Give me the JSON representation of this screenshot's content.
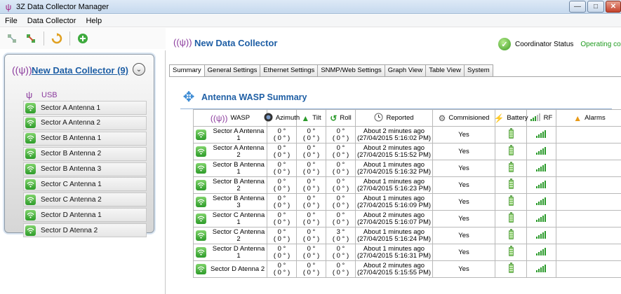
{
  "window": {
    "title": "3Z Data Collector Manager",
    "minimize": "—",
    "maximize": "□",
    "close": "✕"
  },
  "menu": [
    "File",
    "Data Collector",
    "Help"
  ],
  "sidebar": {
    "collector_name": "New Data Collector (9)",
    "usb_label": "USB",
    "items": [
      "Sector A Antenna 1",
      "Sector A Antenna 2",
      "Sector B Antenna 1",
      "Sector B Antenna 2",
      "Sector B Antenna 3",
      "Sector C Antenna 1",
      "Sector C Antenna 2",
      "Sector D Antenna 1",
      "Sector D Atenna 2"
    ]
  },
  "main": {
    "title": "New Data Collector",
    "coordinator_label": "Coordinator Status",
    "coordinator_value": "Operating correctly",
    "tabs": [
      "Summary",
      "General Settings",
      "Ethernet Settings",
      "SNMP/Web Settings",
      "Graph View",
      "Table View",
      "System"
    ],
    "section_title": "Antenna WASP Summary"
  },
  "table": {
    "headers": [
      "WASP",
      "Azimuth",
      "Tilt",
      "Roll",
      "Reported",
      "Commisioned",
      "Battery",
      "RF",
      "Alarms"
    ],
    "rows": [
      {
        "name": "Sector A Antenna 1",
        "az1": "0 °",
        "az2": "( 0 ° )",
        "tilt1": "0 °",
        "tilt2": "( 0 ° )",
        "roll1": "0 °",
        "roll2": "( 0 ° )",
        "rep1": "About 2 minutes ago",
        "rep2": "(27/04/2015 5:16:02 PM)",
        "comm": "Yes"
      },
      {
        "name": "Sector A Antenna 2",
        "az1": "0 °",
        "az2": "( 0 ° )",
        "tilt1": "0 °",
        "tilt2": "( 0 ° )",
        "roll1": "0 °",
        "roll2": "( 0 ° )",
        "rep1": "About 2 minutes ago",
        "rep2": "(27/04/2015 5:15:52 PM)",
        "comm": "Yes"
      },
      {
        "name": "Sector B Antenna 1",
        "az1": "0 °",
        "az2": "( 0 ° )",
        "tilt1": "0 °",
        "tilt2": "( 0 ° )",
        "roll1": "0 °",
        "roll2": "( 0 ° )",
        "rep1": "About 1 minutes ago",
        "rep2": "(27/04/2015 5:16:32 PM)",
        "comm": "Yes"
      },
      {
        "name": "Sector B Antenna 2",
        "az1": "0 °",
        "az2": "( 0 ° )",
        "tilt1": "0 °",
        "tilt2": "( 0 ° )",
        "roll1": "0 °",
        "roll2": "( 0 ° )",
        "rep1": "About 1 minutes ago",
        "rep2": "(27/04/2015 5:16:23 PM)",
        "comm": "Yes"
      },
      {
        "name": "Sector B Antenna 3",
        "az1": "0 °",
        "az2": "( 0 ° )",
        "tilt1": "0 °",
        "tilt2": "( 0 ° )",
        "roll1": "0 °",
        "roll2": "( 0 ° )",
        "rep1": "About 1 minutes ago",
        "rep2": "(27/04/2015 5:16:09 PM)",
        "comm": "Yes"
      },
      {
        "name": "Sector C Antenna 1",
        "az1": "0 °",
        "az2": "( 0 ° )",
        "tilt1": "0 °",
        "tilt2": "( 0 ° )",
        "roll1": "0 °",
        "roll2": "( 0 ° )",
        "rep1": "About 2 minutes ago",
        "rep2": "(27/04/2015 5:16:07 PM)",
        "comm": "Yes"
      },
      {
        "name": "Sector C Antenna 2",
        "az1": "0 °",
        "az2": "( 0 ° )",
        "tilt1": "0 °",
        "tilt2": "( 0 ° )",
        "roll1": "3 °",
        "roll2": "( 0 ° )",
        "rep1": "About 1 minutes ago",
        "rep2": "(27/04/2015 5:16:24 PM)",
        "comm": "Yes"
      },
      {
        "name": "Sector D Antenna 1",
        "az1": "0 °",
        "az2": "( 0 ° )",
        "tilt1": "0 °",
        "tilt2": "( 0 ° )",
        "roll1": "0 °",
        "roll2": "( 0 ° )",
        "rep1": "About 1 minutes ago",
        "rep2": "(27/04/2015 5:16:31 PM)",
        "comm": "Yes"
      },
      {
        "name": "Sector D Atenna 2",
        "az1": "0 °",
        "az2": "( 0 ° )",
        "tilt1": "0 °",
        "tilt2": "( 0 ° )",
        "roll1": "0 °",
        "roll2": "( 0 ° )",
        "rep1": "About 2 minutes ago",
        "rep2": "(27/04/2015 5:15:55 PM)",
        "comm": "Yes"
      }
    ]
  },
  "icons": {
    "toolbar": [
      "network-disconnect-icon",
      "network-connect-icon",
      "refresh-icon",
      "add-icon"
    ],
    "headers": [
      "antenna-icon",
      "compass-icon",
      "up-arrow-icon",
      "roll-arrow-icon",
      "clock-icon",
      "gear-icon",
      "battery-icon",
      "signal-icon",
      "warning-icon"
    ]
  },
  "colors": {
    "accent": "#1f5fa5",
    "ok_green": "#1e9a1e",
    "wasp_purple": "#8b3b9d"
  }
}
